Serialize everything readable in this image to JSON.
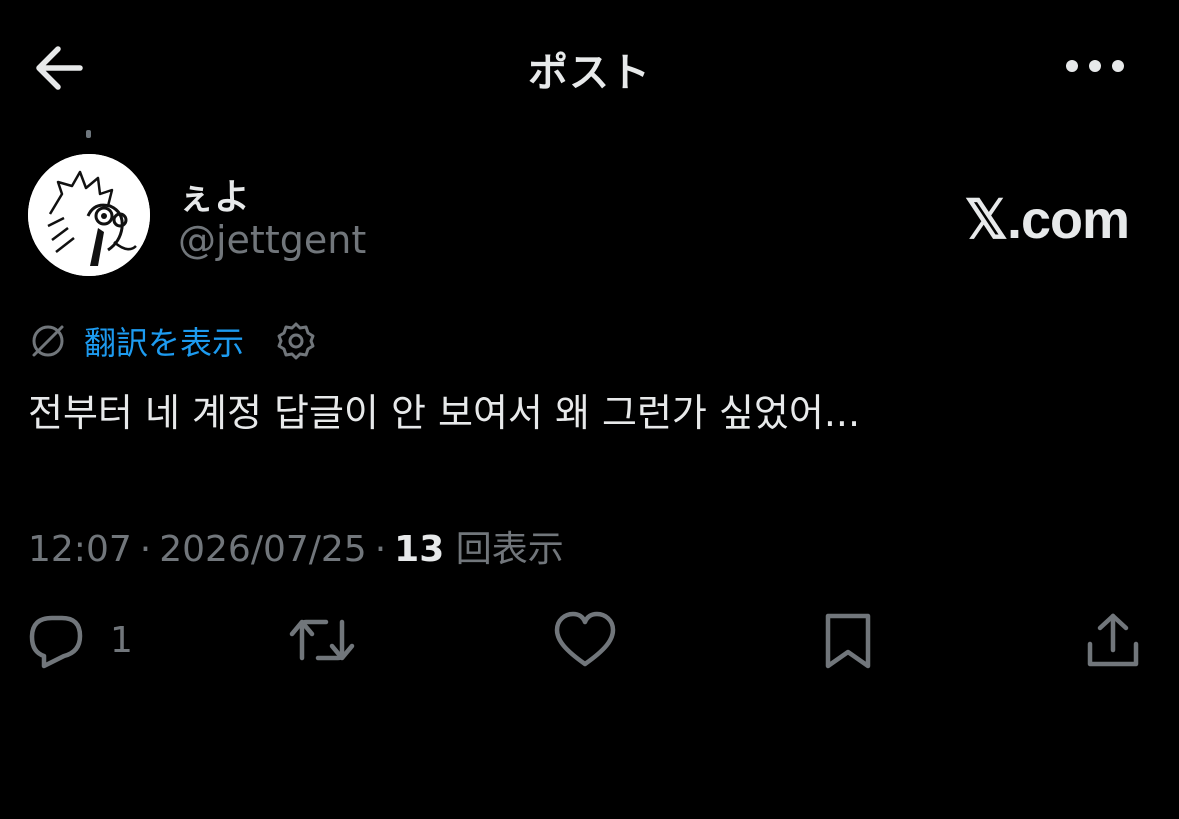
{
  "header": {
    "title": "ポスト",
    "back_icon": "arrow-left-icon",
    "more_icon": "more-horizontal-icon"
  },
  "author": {
    "display_name": "ぇよ",
    "handle": "@jettgent",
    "avatar_icon": "avatar-sketch-image"
  },
  "watermark": "𝕏.com",
  "translate": {
    "label": "翻訳を表示",
    "icon": "translate-globe-icon",
    "settings_icon": "gear-icon"
  },
  "post": {
    "text": "전부터 네 계정 답글이 안 보여서 왜 그런가 싶었어..."
  },
  "meta": {
    "time": "12:07",
    "date": "2026/07/25",
    "separator": "·",
    "views_count": "13",
    "views_label": "回表示"
  },
  "actions": {
    "reply_count": "1"
  },
  "colors": {
    "background": "#000000",
    "text_primary": "#e7e9ea",
    "text_secondary": "#71767b",
    "link": "#1d9bf0"
  }
}
